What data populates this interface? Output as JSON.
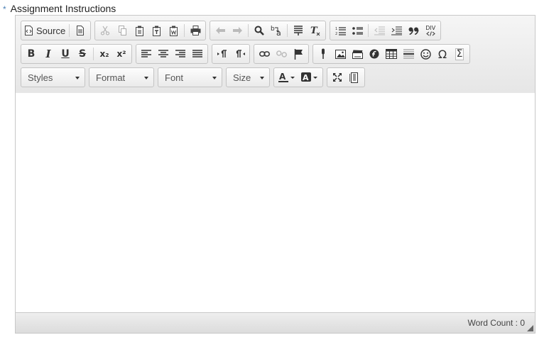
{
  "field": {
    "label": "Assignment Instructions",
    "required_marker": "*"
  },
  "toolbar": {
    "source_label": "Source",
    "bold": "B",
    "italic": "I",
    "underline": "U",
    "strike": "S",
    "subscript": "x₂",
    "superscript": "x²",
    "div": "DIV",
    "omega": "Ω",
    "sigma": "Σ",
    "combos": {
      "styles": "Styles",
      "format": "Format",
      "font": "Font",
      "size": "Size"
    }
  },
  "status": {
    "word_count": "Word Count : 0"
  },
  "content": {
    "text": ""
  }
}
